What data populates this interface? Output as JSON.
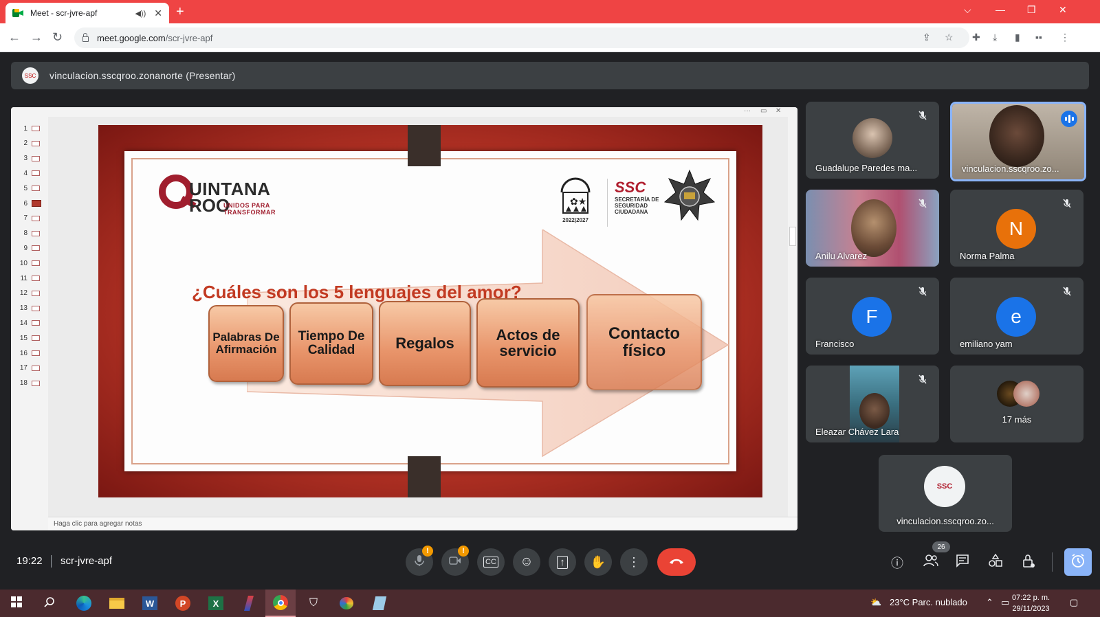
{
  "browser": {
    "tab_title": "Meet - scr-jvre-apf",
    "url_host": "meet.google.com",
    "url_path": "/scr-jvre-apf"
  },
  "meet": {
    "presenter_label": "vinculacion.sscqroo.zonanorte (Presentar)",
    "time": "19:22",
    "meeting_code": "scr-jvre-apf",
    "participant_count": "26"
  },
  "slideshow": {
    "slide_numbers": [
      "1",
      "2",
      "3",
      "4",
      "5",
      "6",
      "7",
      "8",
      "9",
      "10",
      "11",
      "12",
      "13",
      "14",
      "15",
      "16",
      "17",
      "18"
    ],
    "active_slide": 6,
    "notes_placeholder": "Haga clic para agregar notas"
  },
  "slide": {
    "logo_line1": "UINTANA",
    "logo_line2": "ROO",
    "logo_tagline": "UNIDOS PARA TRANSFORMAR",
    "seal_year": "2022|2027",
    "ssc_title": "SSC",
    "ssc_subtitle": "SECRETARÍA DE SEGURIDAD CIUDADANA",
    "question": "¿Cuáles son los 5 lenguajes del amor?",
    "boxes": [
      "Palabras De Afirmación",
      "Tiempo De Calidad",
      "Regalos",
      "Actos de servicio",
      "Contacto físico"
    ]
  },
  "participants": [
    {
      "name": "Guadalupe Paredes ma...",
      "muted": true
    },
    {
      "name": "vinculacion.sscqroo.zo...",
      "speaking": true
    },
    {
      "name": "Anilu Alvarez",
      "muted": true
    },
    {
      "name": "Norma Palma",
      "initial": "N",
      "color": "#e8710a",
      "muted": true
    },
    {
      "name": "Francisco",
      "initial": "F",
      "color": "#1a73e8",
      "muted": true
    },
    {
      "name": "emiliano yam",
      "initial": "e",
      "color": "#1a73e8",
      "muted": true
    },
    {
      "name": "Eleazar Chávez Lara",
      "muted": true
    },
    {
      "name": "17 más"
    },
    {
      "name": "vinculacion.sscqroo.zo..."
    }
  ],
  "taskbar": {
    "weather": "23°C  Parc. nublado",
    "clock_time": "07:22 p. m.",
    "clock_date": "29/11/2023"
  },
  "icons": [
    "back-icon",
    "forward-icon",
    "reload-icon",
    "lock-icon",
    "share-icon",
    "star-icon",
    "extensions-icon",
    "download-icon",
    "sidepanel-icon",
    "profile-icon",
    "menu-icon",
    "mic-icon",
    "camera-icon",
    "captions-icon",
    "emoji-icon",
    "present-icon",
    "hand-icon",
    "more-icon",
    "end-call-icon",
    "info-icon",
    "people-icon",
    "chat-icon",
    "activities-icon",
    "host-controls-icon",
    "timer-icon",
    "windows-icon",
    "search-icon",
    "edge-icon",
    "folder-icon",
    "word-icon",
    "powerpoint-icon",
    "excel-icon",
    "chrome-icon"
  ]
}
